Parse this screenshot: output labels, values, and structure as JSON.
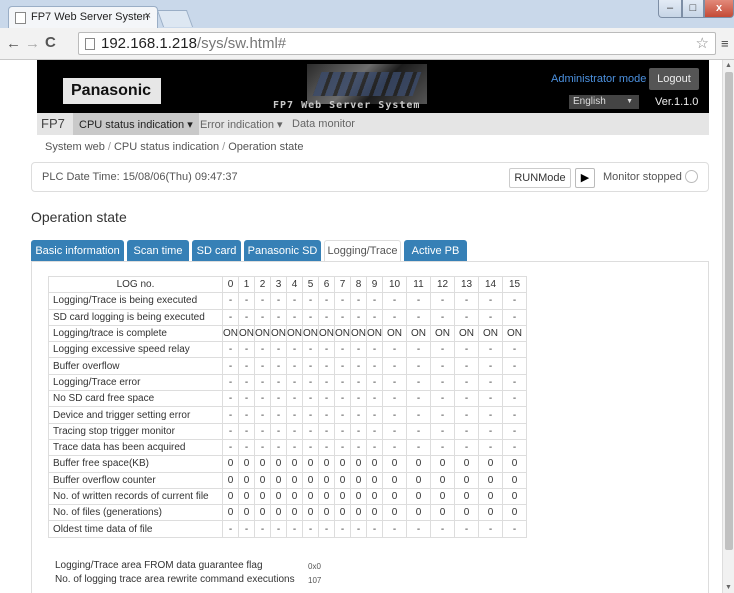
{
  "browser": {
    "tab_title": "FP7 Web Server Systen",
    "tab_close": "×",
    "url_host": "192.168.1.218",
    "url_path": "/sys/sw.html#",
    "window_controls": {
      "minimize": "–",
      "maximize": "□",
      "close": "x"
    }
  },
  "header": {
    "brand": "Panasonic",
    "product": "FP7 Web Server System",
    "mode": "Administrator mode",
    "logout": "Logout",
    "language": "English",
    "version": "Ver.1.1.0"
  },
  "menu": {
    "root": "FP7",
    "items": [
      "CPU status indication",
      "Error indication",
      "Data monitor"
    ]
  },
  "breadcrumb": [
    "System web",
    "CPU status indication",
    "Operation state"
  ],
  "status": {
    "plc_time": "PLC Date Time: 15/08/06(Thu) 09:47:37",
    "run_mode": "RUNMode",
    "monitor": "Monitor stopped"
  },
  "section_title": "Operation state",
  "tabs": [
    "Basic information",
    "Scan time",
    "SD card",
    "Panasonic SD",
    "Logging/Trace",
    "Active PB"
  ],
  "selected_tab": "Logging/Trace",
  "table": {
    "header": "LOG no.",
    "columns": [
      "0",
      "1",
      "2",
      "3",
      "4",
      "5",
      "6",
      "7",
      "8",
      "9",
      "10",
      "11",
      "12",
      "13",
      "14",
      "15"
    ],
    "rows": [
      {
        "label": "Logging/Trace is being executed",
        "values": [
          "-",
          "-",
          "-",
          "-",
          "-",
          "-",
          "-",
          "-",
          "-",
          "-",
          "-",
          "-",
          "-",
          "-",
          "-",
          "-"
        ]
      },
      {
        "label": "SD card logging is being executed",
        "values": [
          "-",
          "-",
          "-",
          "-",
          "-",
          "-",
          "-",
          "-",
          "-",
          "-",
          "-",
          "-",
          "-",
          "-",
          "-",
          "-"
        ]
      },
      {
        "label": "Logging/trace is complete",
        "values": [
          "ON",
          "ON",
          "ON",
          "ON",
          "ON",
          "ON",
          "ON",
          "ON",
          "ON",
          "ON",
          "ON",
          "ON",
          "ON",
          "ON",
          "ON",
          "ON"
        ]
      },
      {
        "label": "Logging excessive speed relay",
        "values": [
          "-",
          "-",
          "-",
          "-",
          "-",
          "-",
          "-",
          "-",
          "-",
          "-",
          "-",
          "-",
          "-",
          "-",
          "-",
          "-"
        ]
      },
      {
        "label": "Buffer overflow",
        "values": [
          "-",
          "-",
          "-",
          "-",
          "-",
          "-",
          "-",
          "-",
          "-",
          "-",
          "-",
          "-",
          "-",
          "-",
          "-",
          "-"
        ]
      },
      {
        "label": "Logging/Trace error",
        "values": [
          "-",
          "-",
          "-",
          "-",
          "-",
          "-",
          "-",
          "-",
          "-",
          "-",
          "-",
          "-",
          "-",
          "-",
          "-",
          "-"
        ]
      },
      {
        "label": "No SD card free space",
        "values": [
          "-",
          "-",
          "-",
          "-",
          "-",
          "-",
          "-",
          "-",
          "-",
          "-",
          "-",
          "-",
          "-",
          "-",
          "-",
          "-"
        ]
      },
      {
        "label": "Device and trigger setting error",
        "values": [
          "-",
          "-",
          "-",
          "-",
          "-",
          "-",
          "-",
          "-",
          "-",
          "-",
          "-",
          "-",
          "-",
          "-",
          "-",
          "-"
        ]
      },
      {
        "label": "Tracing stop trigger monitor",
        "values": [
          "-",
          "-",
          "-",
          "-",
          "-",
          "-",
          "-",
          "-",
          "-",
          "-",
          "-",
          "-",
          "-",
          "-",
          "-",
          "-"
        ]
      },
      {
        "label": "Trace data has been acquired",
        "values": [
          "-",
          "-",
          "-",
          "-",
          "-",
          "-",
          "-",
          "-",
          "-",
          "-",
          "-",
          "-",
          "-",
          "-",
          "-",
          "-"
        ]
      },
      {
        "label": "Buffer free space(KB)",
        "values": [
          "0",
          "0",
          "0",
          "0",
          "0",
          "0",
          "0",
          "0",
          "0",
          "0",
          "0",
          "0",
          "0",
          "0",
          "0",
          "0"
        ]
      },
      {
        "label": "Buffer overflow counter",
        "values": [
          "0",
          "0",
          "0",
          "0",
          "0",
          "0",
          "0",
          "0",
          "0",
          "0",
          "0",
          "0",
          "0",
          "0",
          "0",
          "0"
        ]
      },
      {
        "label": "No. of written records of current file",
        "values": [
          "0",
          "0",
          "0",
          "0",
          "0",
          "0",
          "0",
          "0",
          "0",
          "0",
          "0",
          "0",
          "0",
          "0",
          "0",
          "0"
        ]
      },
      {
        "label": "No. of files (generations)",
        "values": [
          "0",
          "0",
          "0",
          "0",
          "0",
          "0",
          "0",
          "0",
          "0",
          "0",
          "0",
          "0",
          "0",
          "0",
          "0",
          "0"
        ]
      },
      {
        "label": "Oldest time data of file",
        "values": [
          "-",
          "-",
          "-",
          "-",
          "-",
          "-",
          "-",
          "-",
          "-",
          "-",
          "-",
          "-",
          "-",
          "-",
          "-",
          "-"
        ]
      }
    ]
  },
  "footer": {
    "flag_label": "Logging/Trace area FROM data guarantee flag",
    "flag_value": "0x0",
    "count_label": "No. of logging trace area rewrite command executions",
    "count_value": "107"
  },
  "colors": {
    "tab_active": "#3680b6",
    "accent_text": "#4c91df",
    "banner": "#000000"
  }
}
